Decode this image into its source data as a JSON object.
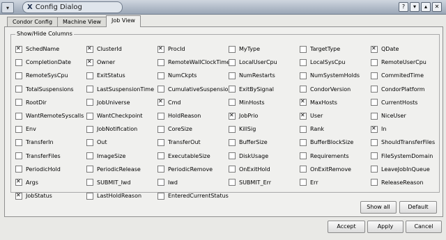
{
  "window": {
    "title": "Config Dialog",
    "title_glyph": "X"
  },
  "titlebar_buttons": [
    "?",
    "▾",
    "▴",
    "✕"
  ],
  "tabs": [
    {
      "label": "Condor Config",
      "active": false
    },
    {
      "label": "Machine View",
      "active": false
    },
    {
      "label": "Job View",
      "active": true
    }
  ],
  "group": {
    "title": "Show/Hide Columns"
  },
  "columns": [
    {
      "label": "SchedName",
      "checked": true
    },
    {
      "label": "ClusterId",
      "checked": true
    },
    {
      "label": "ProcId",
      "checked": true
    },
    {
      "label": "MyType",
      "checked": false
    },
    {
      "label": "TargetType",
      "checked": false
    },
    {
      "label": "QDate",
      "checked": true
    },
    {
      "label": "CompletionDate",
      "checked": false
    },
    {
      "label": "Owner",
      "checked": true
    },
    {
      "label": "RemoteWallClockTime",
      "checked": false
    },
    {
      "label": "LocalUserCpu",
      "checked": false
    },
    {
      "label": "LocalSysCpu",
      "checked": false
    },
    {
      "label": "RemoteUserCpu",
      "checked": false
    },
    {
      "label": "RemoteSysCpu",
      "checked": false
    },
    {
      "label": "ExitStatus",
      "checked": false
    },
    {
      "label": "NumCkpts",
      "checked": false
    },
    {
      "label": "NumRestarts",
      "checked": false
    },
    {
      "label": "NumSystemHolds",
      "checked": false
    },
    {
      "label": "CommitedTime",
      "checked": false
    },
    {
      "label": "TotalSuspensions",
      "checked": false
    },
    {
      "label": "LastSuspensionTime",
      "checked": false
    },
    {
      "label": "CumulativeSuspensionTime",
      "checked": false
    },
    {
      "label": "ExitBySignal",
      "checked": false
    },
    {
      "label": "CondorVersion",
      "checked": false
    },
    {
      "label": "CondorPlatform",
      "checked": false
    },
    {
      "label": "RootDir",
      "checked": false
    },
    {
      "label": "JobUniverse",
      "checked": false
    },
    {
      "label": "Cmd",
      "checked": true
    },
    {
      "label": "MinHosts",
      "checked": false
    },
    {
      "label": "MaxHosts",
      "checked": true
    },
    {
      "label": "CurrentHosts",
      "checked": false
    },
    {
      "label": "WantRemoteSyscalls",
      "checked": false
    },
    {
      "label": "WantCheckpoint",
      "checked": false
    },
    {
      "label": "HoldReason",
      "checked": false
    },
    {
      "label": "JobPrio",
      "checked": true
    },
    {
      "label": "User",
      "checked": true
    },
    {
      "label": "NiceUser",
      "checked": false
    },
    {
      "label": "Env",
      "checked": false
    },
    {
      "label": "JobNotification",
      "checked": false
    },
    {
      "label": "CoreSize",
      "checked": false
    },
    {
      "label": "KillSig",
      "checked": false
    },
    {
      "label": "Rank",
      "checked": false
    },
    {
      "label": "In",
      "checked": true
    },
    {
      "label": "TransferIn",
      "checked": false
    },
    {
      "label": "Out",
      "checked": false
    },
    {
      "label": "TransferOut",
      "checked": false
    },
    {
      "label": "BufferSize",
      "checked": false
    },
    {
      "label": "BufferBlockSize",
      "checked": false
    },
    {
      "label": "ShouldTransferFiles",
      "checked": false
    },
    {
      "label": "TransferFiles",
      "checked": false
    },
    {
      "label": "ImageSize",
      "checked": false
    },
    {
      "label": "ExecutableSize",
      "checked": false
    },
    {
      "label": "DiskUsage",
      "checked": false
    },
    {
      "label": "Requirements",
      "checked": false
    },
    {
      "label": "FileSystemDomain",
      "checked": false
    },
    {
      "label": "PeriodicHold",
      "checked": false
    },
    {
      "label": "PeriodicRelease",
      "checked": false
    },
    {
      "label": "PeriodicRemove",
      "checked": false
    },
    {
      "label": "OnExitHold",
      "checked": false
    },
    {
      "label": "OnExitRemove",
      "checked": false
    },
    {
      "label": "LeaveJobInQueue",
      "checked": false
    },
    {
      "label": "Args",
      "checked": true
    },
    {
      "label": "SUBMIT_Iwd",
      "checked": false
    },
    {
      "label": "Iwd",
      "checked": false
    },
    {
      "label": "SUBMIT_Err",
      "checked": false
    },
    {
      "label": "Err",
      "checked": false
    },
    {
      "label": "ReleaseReason",
      "checked": false
    },
    {
      "label": "JobStatus",
      "checked": true
    },
    {
      "label": "LastHoldReason",
      "checked": false
    },
    {
      "label": "EnteredCurrentStatus",
      "checked": false
    }
  ],
  "buttons": {
    "show_all": "Show all",
    "default": "Default",
    "accept": "Accept",
    "apply": "Apply",
    "cancel": "Cancel"
  }
}
